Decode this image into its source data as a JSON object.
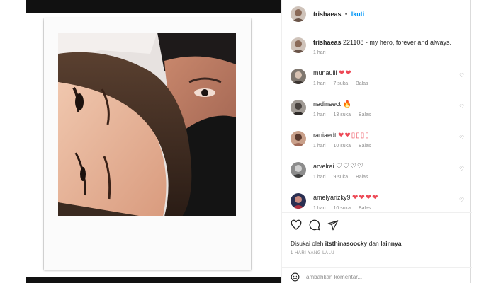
{
  "post": {
    "author": "trishaeas",
    "separator": "•",
    "follow_label": "Ikuti",
    "caption_text": "221108 - my hero, forever and always.",
    "caption_time": "1 hari"
  },
  "comments": [
    {
      "user": "munaulii",
      "text": "❤❤",
      "time": "1 hari",
      "likes": "7 suka",
      "reply": "Balas"
    },
    {
      "user": "nadineect",
      "text": "🔥",
      "time": "1 hari",
      "likes": "13 suka",
      "reply": "Balas"
    },
    {
      "user": "raniaedt",
      "text": "❤❤▯▯▯▯",
      "time": "1 hari",
      "likes": "10 suka",
      "reply": "Balas"
    },
    {
      "user": "arvelrai",
      "text": "♡♡♡♡",
      "time": "1 hari",
      "likes": "9 suka",
      "reply": "Balas"
    },
    {
      "user": "amelyarizky9",
      "text": "❤❤❤❤",
      "time": "1 hari",
      "likes": "10 suka",
      "reply": "Balas"
    }
  ],
  "actions": {
    "like_icon": "heart-icon",
    "comment_icon": "comment-icon",
    "share_icon": "share-icon"
  },
  "likes": {
    "prefix": "Disukai oleh",
    "user": "itsthinasoocky",
    "conj": "dan",
    "others": "lainnya"
  },
  "date_label": "1 HARI YANG LALU",
  "add_comment": {
    "placeholder": "Tambahkan komentar...",
    "icon": "emoji-icon"
  },
  "colors": {
    "like_red": "#ed4956",
    "link_blue": "#0095f6",
    "meta_gray": "#8e8e8e"
  }
}
